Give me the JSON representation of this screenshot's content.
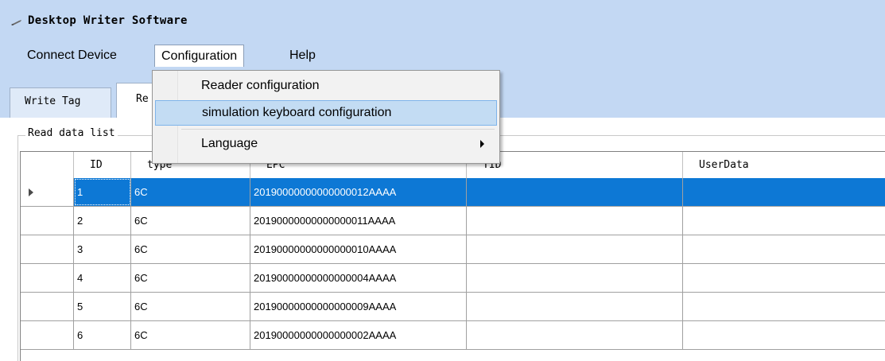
{
  "window": {
    "title": "Desktop Writer Software",
    "icon": "app-pen-icon"
  },
  "menubar": {
    "items": [
      {
        "label": "Connect Device"
      },
      {
        "label": "Configuration"
      },
      {
        "label": "Help"
      }
    ],
    "open_menu": "Configuration"
  },
  "dropdown": {
    "items": [
      {
        "label": "Reader configuration"
      },
      {
        "label": "simulation keyboard configuration"
      },
      {
        "label": "Language",
        "has_submenu": true
      }
    ],
    "highlighted_index": 1
  },
  "tabs": [
    {
      "label": "Write Tag"
    },
    {
      "label": "Re"
    }
  ],
  "group": {
    "label": "Read data list"
  },
  "grid": {
    "columns": [
      "ID",
      "type",
      "EPC",
      "TID",
      "UserData"
    ],
    "selected_row_index": 0,
    "rows": [
      {
        "id": "1",
        "type": "6C",
        "epc": "20190000000000000012AAAA",
        "tid": "",
        "user": ""
      },
      {
        "id": "2",
        "type": "6C",
        "epc": "20190000000000000011AAAA",
        "tid": "",
        "user": ""
      },
      {
        "id": "3",
        "type": "6C",
        "epc": "20190000000000000010AAAA",
        "tid": "",
        "user": ""
      },
      {
        "id": "4",
        "type": "6C",
        "epc": "20190000000000000004AAAA",
        "tid": "",
        "user": ""
      },
      {
        "id": "5",
        "type": "6C",
        "epc": "20190000000000000009AAAA",
        "tid": "",
        "user": ""
      },
      {
        "id": "6",
        "type": "6C",
        "epc": "20190000000000000002AAAA",
        "tid": "",
        "user": ""
      }
    ]
  },
  "colors": {
    "chrome": "#c3d8f3",
    "selection": "#0d78d5",
    "menu_hover": "#c3dcf3"
  }
}
